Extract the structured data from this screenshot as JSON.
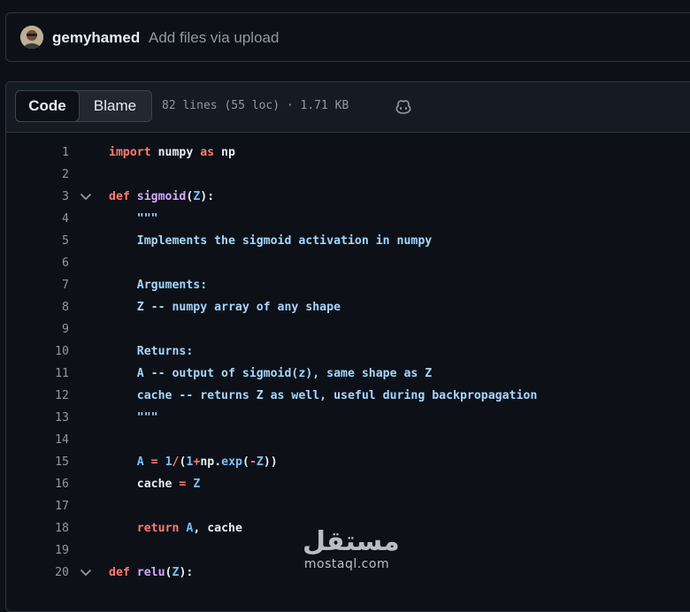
{
  "commit": {
    "author": "gemyhamed",
    "message": "Add files via upload",
    "avatar_icon": "user-avatar"
  },
  "file_header": {
    "tabs": [
      {
        "label": "Code",
        "selected": true
      },
      {
        "label": "Blame",
        "selected": false
      }
    ],
    "meta": "82 lines (55 loc) · 1.71 KB",
    "copilot_icon": "copilot-icon"
  },
  "code": {
    "lines": [
      {
        "num": "1",
        "fold": false,
        "tokens": [
          [
            "kw",
            "import"
          ],
          [
            "pl",
            " numpy "
          ],
          [
            "kw",
            "as"
          ],
          [
            "pl",
            " np"
          ]
        ]
      },
      {
        "num": "2",
        "fold": false,
        "tokens": []
      },
      {
        "num": "3",
        "fold": true,
        "tokens": [
          [
            "kw",
            "def"
          ],
          [
            "pl",
            " "
          ],
          [
            "fn",
            "sigmoid"
          ],
          [
            "pl",
            "("
          ],
          [
            "cst",
            "Z"
          ],
          [
            "pl",
            "):"
          ]
        ]
      },
      {
        "num": "4",
        "fold": false,
        "tokens": [
          [
            "str",
            "    \"\"\""
          ]
        ]
      },
      {
        "num": "5",
        "fold": false,
        "tokens": [
          [
            "str",
            "    Implements the sigmoid activation in numpy"
          ]
        ]
      },
      {
        "num": "6",
        "fold": false,
        "tokens": [
          [
            "str",
            "    "
          ]
        ]
      },
      {
        "num": "7",
        "fold": false,
        "tokens": [
          [
            "str",
            "    Arguments:"
          ]
        ]
      },
      {
        "num": "8",
        "fold": false,
        "tokens": [
          [
            "str",
            "    Z -- numpy array of any shape"
          ]
        ]
      },
      {
        "num": "9",
        "fold": false,
        "tokens": [
          [
            "str",
            "    "
          ]
        ]
      },
      {
        "num": "10",
        "fold": false,
        "tokens": [
          [
            "str",
            "    Returns:"
          ]
        ]
      },
      {
        "num": "11",
        "fold": false,
        "tokens": [
          [
            "str",
            "    A -- output of sigmoid(z), same shape as Z"
          ]
        ]
      },
      {
        "num": "12",
        "fold": false,
        "tokens": [
          [
            "str",
            "    cache -- returns Z as well, useful during backpropagation"
          ]
        ]
      },
      {
        "num": "13",
        "fold": false,
        "tokens": [
          [
            "str",
            "    \"\"\""
          ]
        ]
      },
      {
        "num": "14",
        "fold": false,
        "tokens": []
      },
      {
        "num": "15",
        "fold": false,
        "tokens": [
          [
            "cst",
            "    A"
          ],
          [
            "pl",
            " "
          ],
          [
            "kw",
            "="
          ],
          [
            "pl",
            " "
          ],
          [
            "cst",
            "1"
          ],
          [
            "kw",
            "/"
          ],
          [
            "pl",
            "("
          ],
          [
            "cst",
            "1"
          ],
          [
            "kw",
            "+"
          ],
          [
            "pl",
            "np."
          ],
          [
            "cst",
            "exp"
          ],
          [
            "pl",
            "("
          ],
          [
            "kw",
            "-"
          ],
          [
            "cst",
            "Z"
          ],
          [
            "pl",
            "))"
          ]
        ]
      },
      {
        "num": "16",
        "fold": false,
        "tokens": [
          [
            "pl",
            "    cache "
          ],
          [
            "kw",
            "="
          ],
          [
            "pl",
            " "
          ],
          [
            "cst",
            "Z"
          ]
        ]
      },
      {
        "num": "17",
        "fold": false,
        "tokens": []
      },
      {
        "num": "18",
        "fold": false,
        "tokens": [
          [
            "kw",
            "    return"
          ],
          [
            "pl",
            " "
          ],
          [
            "cst",
            "A"
          ],
          [
            "pl",
            ", cache"
          ]
        ]
      },
      {
        "num": "19",
        "fold": false,
        "tokens": []
      },
      {
        "num": "20",
        "fold": true,
        "tokens": [
          [
            "kw",
            "def"
          ],
          [
            "pl",
            " "
          ],
          [
            "fn",
            "relu"
          ],
          [
            "pl",
            "("
          ],
          [
            "cst",
            "Z"
          ],
          [
            "pl",
            "):"
          ]
        ]
      }
    ]
  },
  "watermark": {
    "arabic": "مستقل",
    "latin": "mostaql.com"
  },
  "colors": {
    "background": "#0d1117",
    "keyword": "#ff7b72",
    "function": "#d2a8ff",
    "string": "#a5d6ff",
    "constant": "#79c0ff"
  }
}
